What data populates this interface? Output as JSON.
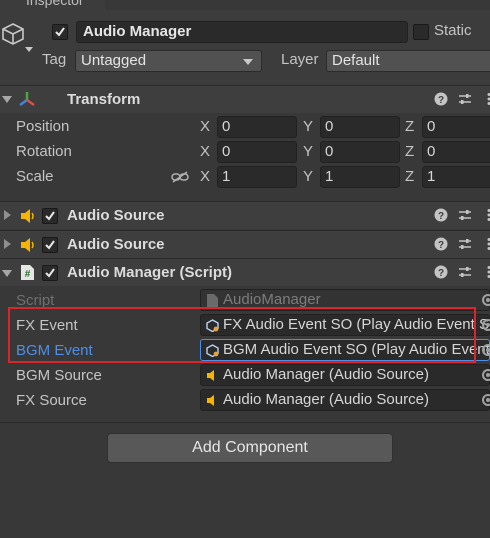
{
  "window": {
    "tab_title": "Inspector"
  },
  "gameobject": {
    "active": true,
    "name": "Audio Manager",
    "static_label": "Static",
    "static_checked": false,
    "tag_label": "Tag",
    "tag_value": "Untagged",
    "layer_label": "Layer",
    "layer_value": "Default"
  },
  "transform": {
    "title": "Transform",
    "rows": [
      {
        "label": "Position",
        "x": "0",
        "y": "0",
        "z": "0"
      },
      {
        "label": "Rotation",
        "x": "0",
        "y": "0",
        "z": "0"
      },
      {
        "label": "Scale",
        "x": "1",
        "y": "1",
        "z": "1"
      }
    ],
    "axis": {
      "x": "X",
      "y": "Y",
      "z": "Z"
    }
  },
  "audio_source_1": {
    "title": "Audio Source",
    "enabled": true
  },
  "audio_source_2": {
    "title": "Audio Source",
    "enabled": true
  },
  "script_component": {
    "title": "Audio Manager (Script)",
    "enabled": true,
    "fields": {
      "script": {
        "label": "Script",
        "value": "AudioManager"
      },
      "fx_event": {
        "label": "FX Event",
        "value": "FX Audio Event SO (Play Audio Event SO)"
      },
      "bgm_event": {
        "label": "BGM Event",
        "value": "BGM Audio Event SO (Play Audio Event SO)"
      },
      "bgm_source": {
        "label": "BGM Source",
        "value": "Audio Manager (Audio Source)"
      },
      "fx_source": {
        "label": "FX Source",
        "value": "Audio Manager (Audio Source)"
      }
    }
  },
  "add_component_label": "Add Component",
  "colors": {
    "background": "#383838",
    "highlight": "#d8262b",
    "selected_label": "#4d8fe8",
    "audio_icon": "#f5b400"
  }
}
